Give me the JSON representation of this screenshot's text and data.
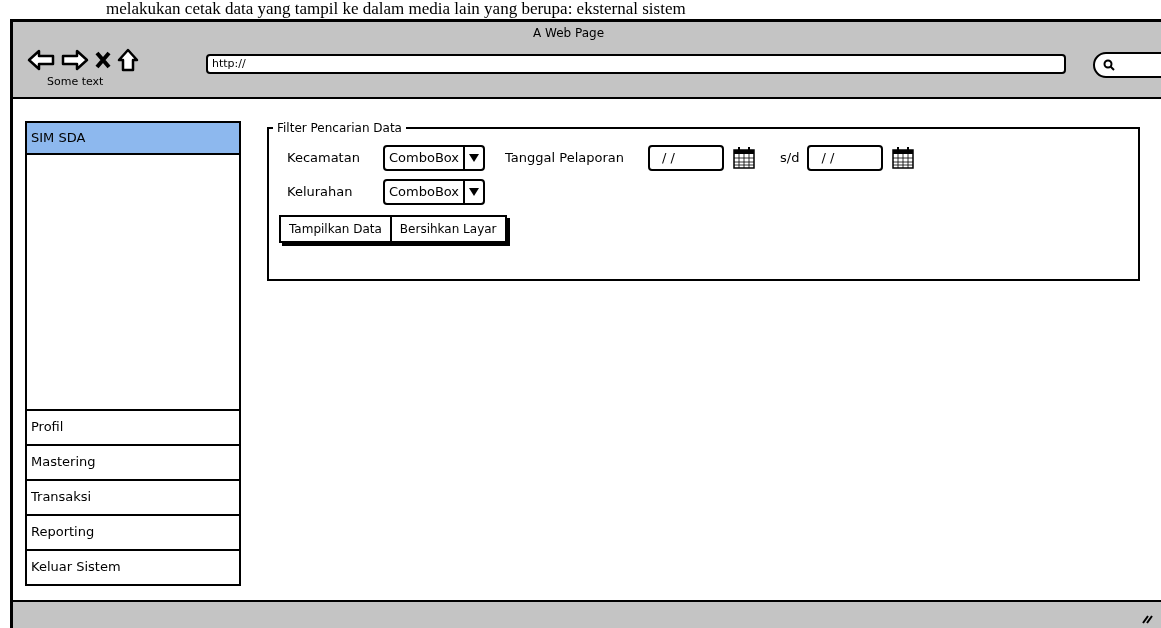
{
  "document_text": "melakukan cetak data yang tampil ke dalam media lain yang berupa: eksternal sistem",
  "browser": {
    "title": "A Web Page",
    "nav_caption": "Some text",
    "url": "http://"
  },
  "sidebar": {
    "items": [
      {
        "label": "SIM SDA",
        "selected": true
      },
      {
        "label": "Profil",
        "selected": false
      },
      {
        "label": "Mastering",
        "selected": false
      },
      {
        "label": "Transaksi",
        "selected": false
      },
      {
        "label": "Reporting",
        "selected": false
      },
      {
        "label": "Keluar Sistem",
        "selected": false
      }
    ]
  },
  "filter": {
    "legend": "Filter Pencarian Data",
    "kecamatan": {
      "label": "Kecamatan",
      "value": "ComboBox"
    },
    "tanggal": {
      "label": "Tanggal Pelaporan",
      "from": "/ /",
      "separator": "s/d",
      "to": "/ /"
    },
    "kelurahan": {
      "label": "Kelurahan",
      "value": "ComboBox"
    },
    "buttons": [
      "Tampilkan Data",
      "Bersihkan Layar"
    ]
  }
}
